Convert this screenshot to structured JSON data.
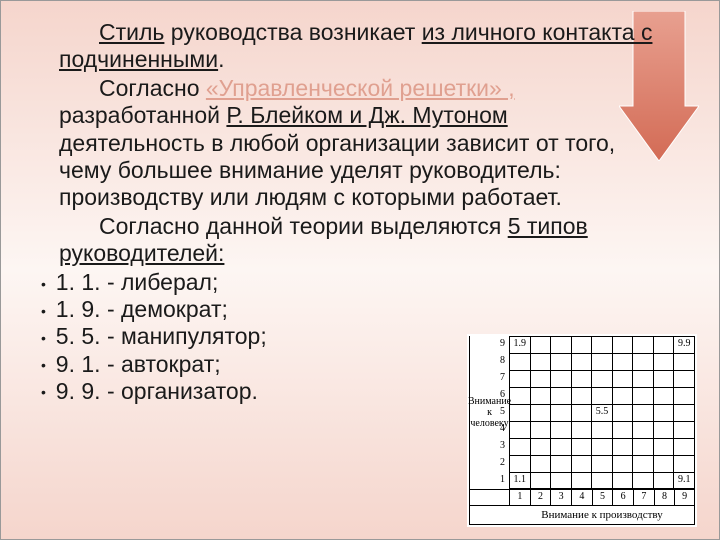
{
  "text": {
    "p1a": "Стиль",
    "p1b": " руководства возникает ",
    "p1c": "из личного контакта с подчиненными",
    "p1d": ".",
    "p2a": "Согласно ",
    "p2b": "«Управленческой решетки» ,",
    "p2c": " разработанной ",
    "p2d": "Р. Блейком и Дж. Мутоном",
    "p2e": " деятельность в любой организации зависит от того, чему большее внимание уделят руководитель: производству или людям с которыми работает.",
    "p3a": "Согласно данной теории выделяются ",
    "p3b": "5 типов руководителей:"
  },
  "bullets": {
    "b1": "1. 1. - либерал;",
    "b2": "1. 9. - демократ;",
    "b3": "5. 5. - манипулятор;",
    "b4": "9. 1. - автократ;",
    "b5": "9. 9. - организатор."
  },
  "chart_data": {
    "type": "heatmap",
    "title": "",
    "xlabel": "Внимание к производству",
    "ylabel": "Внимание к человеку",
    "x_ticks": [
      "1",
      "2",
      "3",
      "4",
      "5",
      "6",
      "7",
      "8",
      "9"
    ],
    "y_ticks": [
      "1",
      "2",
      "3",
      "4",
      "5",
      "6",
      "7",
      "8",
      "9"
    ],
    "points": [
      {
        "x": 1,
        "y": 9,
        "label": "1.9"
      },
      {
        "x": 9,
        "y": 9,
        "label": "9.9"
      },
      {
        "x": 5,
        "y": 5,
        "label": "5.5"
      },
      {
        "x": 1,
        "y": 1,
        "label": "1.1"
      },
      {
        "x": 9,
        "y": 1,
        "label": "9.1"
      }
    ]
  }
}
